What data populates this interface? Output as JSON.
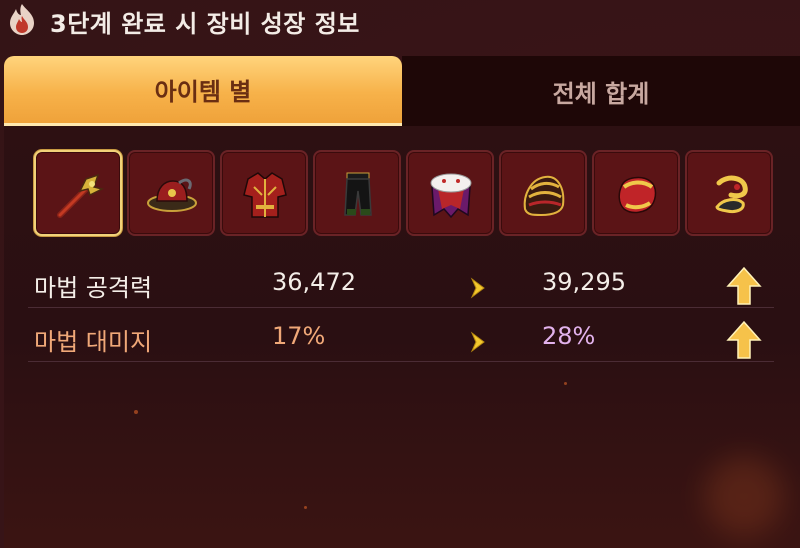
{
  "header": {
    "title": "3단계 완료 시 장비 성장 정보"
  },
  "tabs": [
    {
      "label": "아이템 별",
      "active": true
    },
    {
      "label": "전체 합계",
      "active": false
    }
  ],
  "items": [
    {
      "icon": "staff-icon",
      "selected": true
    },
    {
      "icon": "hat-icon",
      "selected": false
    },
    {
      "icon": "overall-armor-icon",
      "selected": false
    },
    {
      "icon": "pants-icon",
      "selected": false
    },
    {
      "icon": "cape-icon",
      "selected": false
    },
    {
      "icon": "gloves-icon",
      "selected": false
    },
    {
      "icon": "shoes-icon",
      "selected": false
    },
    {
      "icon": "ring-icon",
      "selected": false
    }
  ],
  "stats": [
    {
      "label": "마법 공격력",
      "current": "36,472",
      "next": "39,295",
      "label_color": "#f4eee8",
      "current_color": "#f4eee8",
      "next_color": "#f4eee8"
    },
    {
      "label": "마법 대미지",
      "current": "17%",
      "next": "28%",
      "label_color": "#f0a878",
      "current_color": "#f0a878",
      "next_color": "#e2b2ec"
    }
  ],
  "colors": {
    "tab_active": "#f7b24a",
    "tab_active_text": "#6a2e12",
    "slot_bg": "#5b1416",
    "slot_selected_border": "#f2d27a",
    "arrow": "#f3c82e",
    "up_arrow": "#f6c24a"
  }
}
